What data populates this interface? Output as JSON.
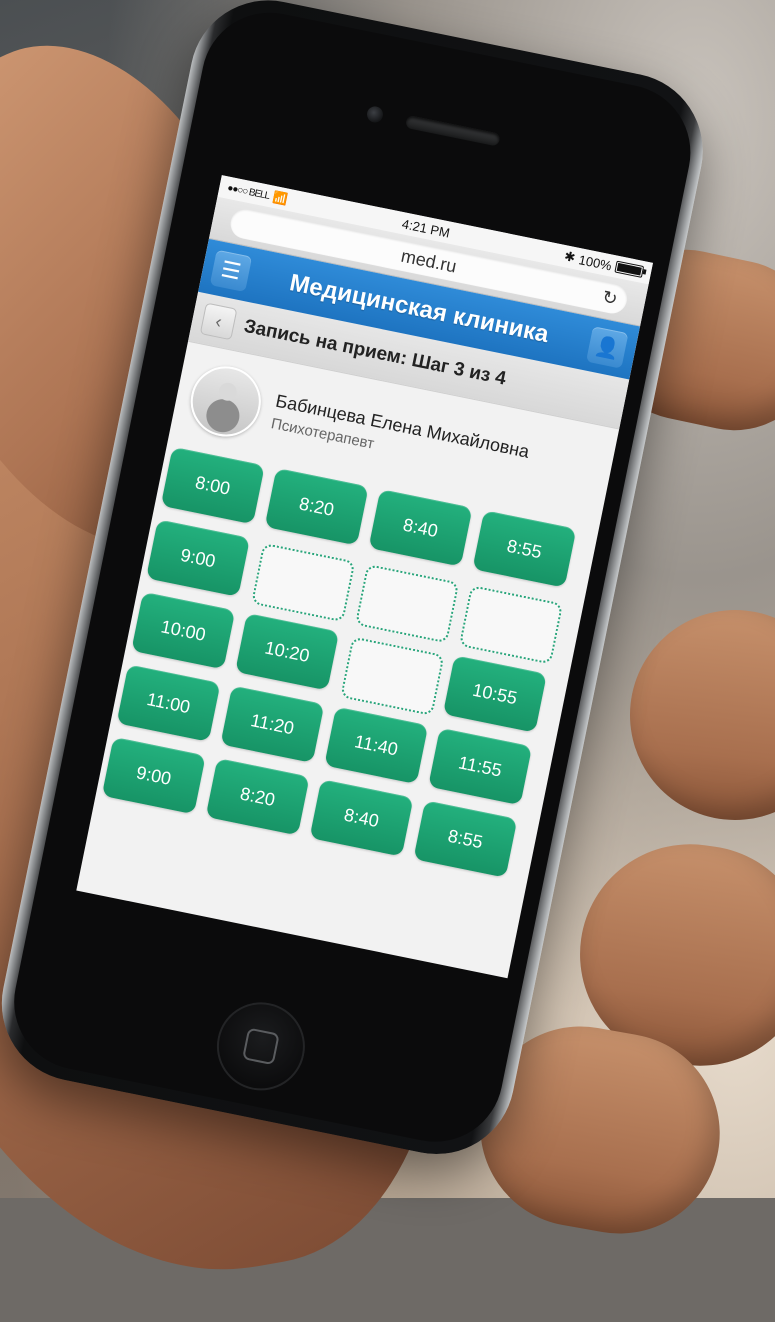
{
  "status_bar": {
    "carrier": "●●○○ BELL",
    "time": "4:21 PM",
    "battery": "100%"
  },
  "browser": {
    "url": "med.ru"
  },
  "app": {
    "title": "Медицинская клиника"
  },
  "booking": {
    "step_title": "Запись на прием: Шаг 3 из 4"
  },
  "doctor": {
    "name": "Бабинцева Елена Михайловна",
    "role": "Психотерапевт"
  },
  "slots": [
    {
      "label": "8:00",
      "state": "available"
    },
    {
      "label": "8:20",
      "state": "available"
    },
    {
      "label": "8:40",
      "state": "available"
    },
    {
      "label": "8:55",
      "state": "available"
    },
    {
      "label": "9:00",
      "state": "available"
    },
    {
      "label": "",
      "state": "empty"
    },
    {
      "label": "",
      "state": "empty"
    },
    {
      "label": "",
      "state": "empty"
    },
    {
      "label": "10:00",
      "state": "available"
    },
    {
      "label": "10:20",
      "state": "available"
    },
    {
      "label": "",
      "state": "empty"
    },
    {
      "label": "10:55",
      "state": "available"
    },
    {
      "label": "11:00",
      "state": "available"
    },
    {
      "label": "11:20",
      "state": "available"
    },
    {
      "label": "11:40",
      "state": "available"
    },
    {
      "label": "11:55",
      "state": "available"
    },
    {
      "label": "9:00",
      "state": "available"
    },
    {
      "label": "8:20",
      "state": "available"
    },
    {
      "label": "8:40",
      "state": "available"
    },
    {
      "label": "8:55",
      "state": "available"
    }
  ],
  "icons": {
    "wifi": "wifi-icon",
    "bluetooth": "bluetooth-icon",
    "battery": "battery-icon",
    "reload": "reload-icon",
    "menu": "menu-icon",
    "user": "user-icon",
    "back": "chevron-left-icon",
    "home_button": "home-button-icon"
  },
  "colors": {
    "header_blue": "#1e74c1",
    "slot_green": "#179466",
    "screen_bg": "#f2f2f2"
  }
}
